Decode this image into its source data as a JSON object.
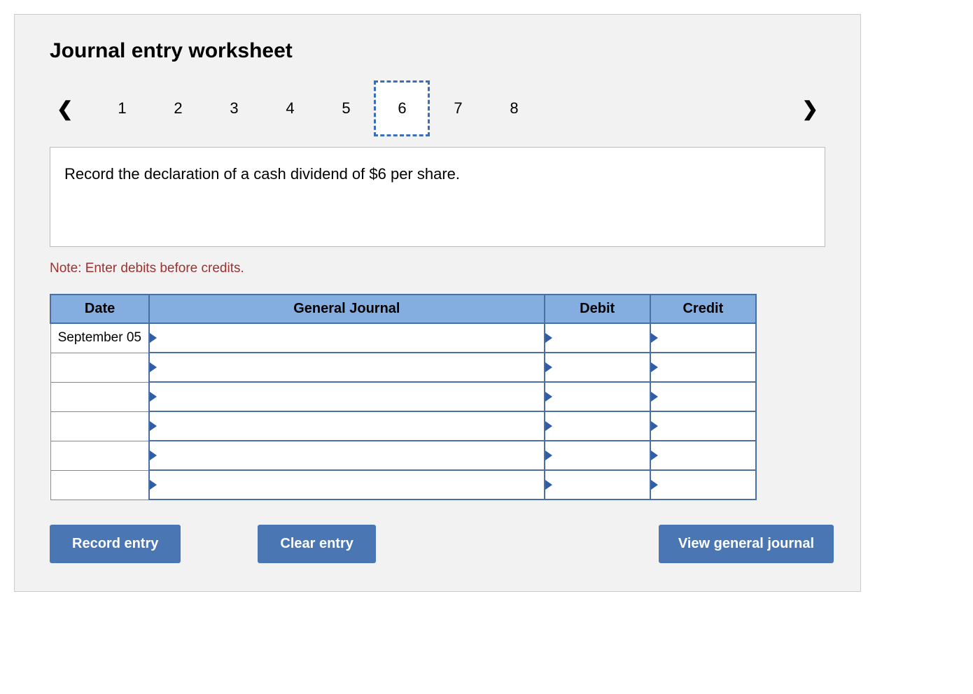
{
  "title": "Journal entry worksheet",
  "nav": {
    "tabs": [
      "1",
      "2",
      "3",
      "4",
      "5",
      "6",
      "7",
      "8"
    ],
    "active_index": 5
  },
  "instruction": "Record the declaration of a cash dividend of $6 per share.",
  "note": "Note: Enter debits before credits.",
  "table": {
    "headers": {
      "date": "Date",
      "general_journal": "General Journal",
      "debit": "Debit",
      "credit": "Credit"
    },
    "rows": [
      {
        "date": "September 05",
        "gj": "",
        "debit": "",
        "credit": ""
      },
      {
        "date": "",
        "gj": "",
        "debit": "",
        "credit": ""
      },
      {
        "date": "",
        "gj": "",
        "debit": "",
        "credit": ""
      },
      {
        "date": "",
        "gj": "",
        "debit": "",
        "credit": ""
      },
      {
        "date": "",
        "gj": "",
        "debit": "",
        "credit": ""
      },
      {
        "date": "",
        "gj": "",
        "debit": "",
        "credit": ""
      }
    ]
  },
  "buttons": {
    "record": "Record entry",
    "clear": "Clear entry",
    "view": "View general journal"
  }
}
